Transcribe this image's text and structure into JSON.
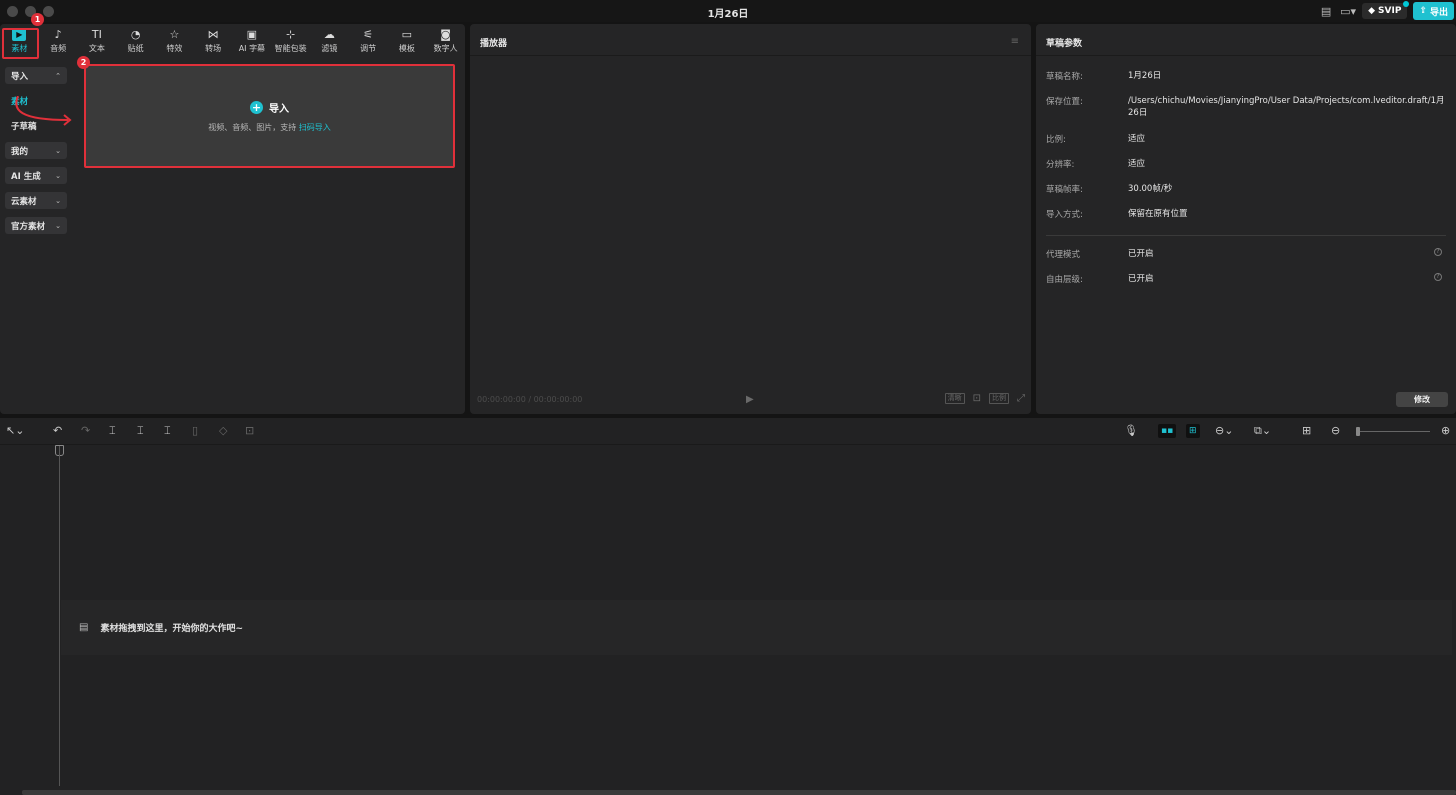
{
  "window": {
    "title": "1月26日"
  },
  "titlebar_right": {
    "svip": "SVIP",
    "export": "导出"
  },
  "toolbar": {
    "tools": [
      {
        "label": "素材",
        "icon": "play-square-icon"
      },
      {
        "label": "音频",
        "icon": "music-note-icon"
      },
      {
        "label": "文本",
        "icon": "text-icon"
      },
      {
        "label": "贴纸",
        "icon": "sticker-icon"
      },
      {
        "label": "特效",
        "icon": "star-effect-icon"
      },
      {
        "label": "转场",
        "icon": "transition-icon"
      },
      {
        "label": "AI 字幕",
        "icon": "subtitle-icon"
      },
      {
        "label": "智能包装",
        "icon": "smart-pack-icon"
      },
      {
        "label": "滤镜",
        "icon": "filter-icon"
      },
      {
        "label": "调节",
        "icon": "adjust-icon"
      },
      {
        "label": "模板",
        "icon": "template-icon"
      },
      {
        "label": "数字人",
        "icon": "avatar-icon"
      }
    ]
  },
  "sidebar": {
    "import": "导入",
    "media": "素材",
    "sub_draft": "子草稿",
    "mine": "我的",
    "ai": "AI 生成",
    "cloud": "云素材",
    "official": "官方素材"
  },
  "import_area": {
    "title": "导入",
    "subtitle": "视频、音频、图片，支持 ",
    "link": "扫码导入"
  },
  "annotations": {
    "badge1": "1",
    "badge2": "2"
  },
  "player": {
    "title": "播放器",
    "timecode": "00:00:00:00 / 00:00:00:00",
    "btn_hd": "清晰",
    "btn_ratio": "比例"
  },
  "draft": {
    "title": "草稿参数",
    "rows": [
      {
        "k": "草稿名称:",
        "v": "1月26日"
      },
      {
        "k": "保存位置:",
        "v": "/Users/chichu/Movies/JianyingPro/User Data/Projects/com.lveditor.draft/1月26日"
      },
      {
        "k": "比例:",
        "v": "适应"
      },
      {
        "k": "分辨率:",
        "v": "适应"
      },
      {
        "k": "草稿帧率:",
        "v": "30.00帧/秒"
      },
      {
        "k": "导入方式:",
        "v": "保留在原有位置"
      },
      {
        "k": "代理模式",
        "v": "已开启"
      },
      {
        "k": "自由层级:",
        "v": "已开启"
      }
    ],
    "modify": "修改"
  },
  "timeline": {
    "drop_text": "素材拖拽到这里，开始你的大作吧~"
  },
  "colors": {
    "accent": "#1fc1d0",
    "highlight": "#e0303a"
  }
}
